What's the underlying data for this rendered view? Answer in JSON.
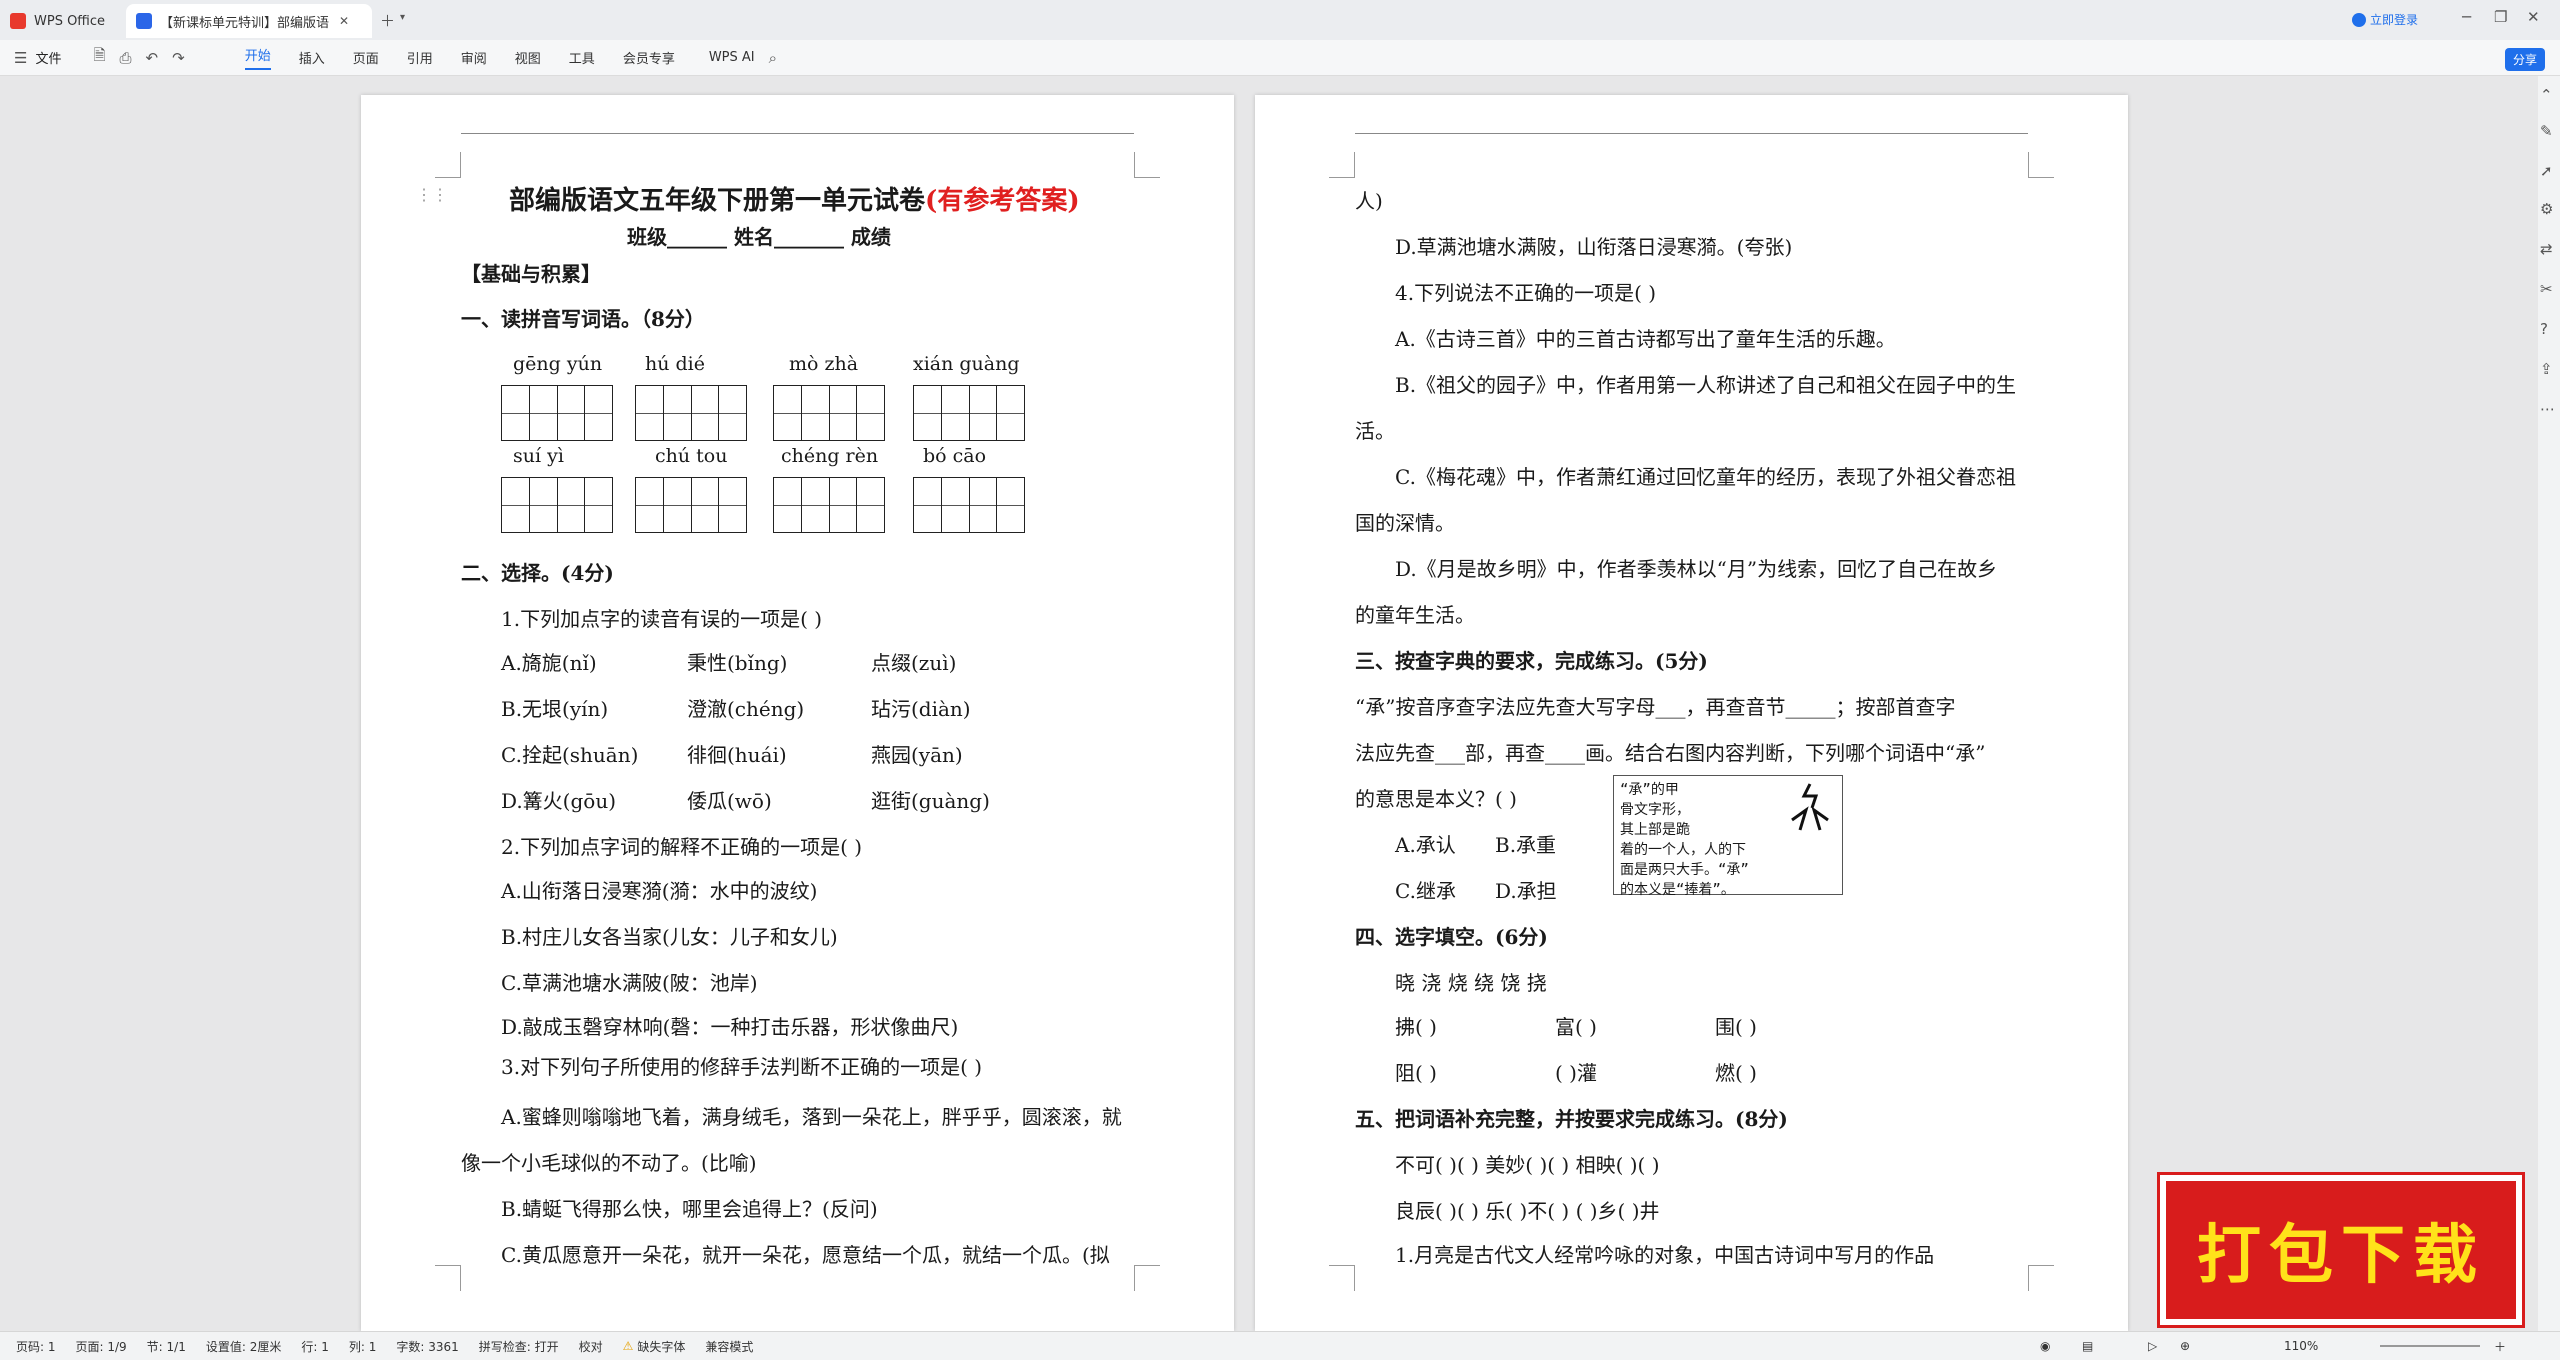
{
  "titlebar": {
    "app_tab": "WPS Office",
    "doc_tab": "【新课标单元特训】部编版语",
    "login": "立即登录"
  },
  "toolbar": {
    "file": "文件",
    "tabs": [
      "开始",
      "插入",
      "页面",
      "引用",
      "审阅",
      "视图",
      "工具",
      "会员专享"
    ],
    "ai": "WPS AI",
    "share": "分享"
  },
  "page1": {
    "title": "部编版语文五年级下册第一单元试卷",
    "title_suffix": "(有参考答案)",
    "info": "班级______   姓名_______   成绩",
    "section0": "【基础与积累】",
    "q1": "一、读拼音写词语。（8分）",
    "pinyin": [
      "gēng yún",
      "hú  dié",
      "mò  zhà",
      "xián guàng",
      "suí  yì",
      "chú tou",
      "chéng rèn",
      "bó  cāo"
    ],
    "q2": "二、选择。(4分)",
    "q2_1": "1.下列加点字的读音有误的一项是(      )",
    "a1": "A.旖旎(nǐ)",
    "a2": "秉性(bǐng)",
    "a3": "点缀(zuì)",
    "b1": "B.无垠(yín)",
    "b2": "澄澈(chéng)",
    "b3": "玷污(diàn)",
    "c1": "C.拴起(shuān)",
    "c2": "徘徊(huái)",
    "c3": "燕园(yān)",
    "d1": "D.篝火(gōu)",
    "d2": "倭瓜(wō)",
    "d3": "逛街(guàng)",
    "q2_2": "2.下列加点字词的解释不正确的一项是(   )",
    "q2_2a": "A.山衔落日浸寒漪(漪：水中的波纹)",
    "q2_2b": "B.村庄儿女各当家(儿女：儿子和女儿)",
    "q2_2c": "C.草满池塘水满陂(陂：池岸)",
    "q2_2d": "D.敲成玉磬穿林响(磬：一种打击乐器，形状像曲尺)",
    "q2_3": "3.对下列句子所使用的修辞手法判断不正确的一项是(   )",
    "q2_3a1": "A.蜜蜂则嗡嗡地飞着，满身绒毛，落到一朵花上，胖乎乎，圆滚滚，就",
    "q2_3a2": "像一个小毛球似的不动了。(比喻)",
    "q2_3b": "B.蜻蜓飞得那么快，哪里会追得上？(反问)",
    "q2_3c": "C.黄瓜愿意开一朵花，就开一朵花，愿意结一个瓜，就结一个瓜。(拟"
  },
  "page2": {
    "l1": "人)",
    "l2": "D.草满池塘水满陂，山衔落日浸寒漪。(夸张)",
    "l3": "4.下列说法不正确的一项是(    )",
    "l4": "A.《古诗三首》中的三首古诗都写出了童年生活的乐趣。",
    "l5": "B.《祖父的园子》中，作者用第一人称讲述了自己和祖父在园子中的生",
    "l6": "活。",
    "l7": "C.《梅花魂》中，作者萧红通过回忆童年的经历，表现了外祖父眷恋祖",
    "l8": "国的深情。",
    "l9": "D.《月是故乡明》中，作者季羡林以“月”为线索，回忆了自己在故乡",
    "l10": "的童年生活。",
    "q3": "三、按查字典的要求，完成练习。(5分)",
    "q3a": "“承”按音序查字法应先查大写字母___，再查音节_____；按部首查字",
    "q3b": "法应先查___部，再查____画。结合右图内容判断，下列哪个词语中“承”",
    "q3c": "的意思是本义？(    )",
    "opt_a": "A.承认",
    "opt_b": "B.承重",
    "opt_c": "C.继承",
    "opt_d": "D.承担",
    "dict": [
      "“承”的甲",
      "骨文字形，",
      "其上部是跪",
      "着的一个人，人的下",
      "面是两只大手。“承”",
      "的本义是“捧着”。"
    ],
    "q4": "四、选字填空。(6分)",
    "chars": "晓      浇      烧      绕      饶      挠",
    "q4r1a": "拂(     )",
    "q4r1b": "富(     )",
    "q4r1c": "围(     )",
    "q4r2a": "阻(     )",
    "q4r2b": "(     )灌",
    "q4r2c": "燃(     )",
    "q5": "五、把词语补充完整，并按要求完成练习。(8分)",
    "q5r1": "不可(   )(   )      美妙(   )(   )      相映(   )(   )",
    "q5r2": "良辰(   )(   )      乐(   )不(   )      (   )乡(   )井",
    "q5r3": "1.月亮是古代文人经常吟咏的对象，中国古诗词中写月的作品"
  },
  "status": {
    "page": "页码: 1",
    "pages": "页面: 1/9",
    "section": "节: 1/1",
    "setting": "设置值: 2厘米",
    "row": "行: 1",
    "col": "列: 1",
    "words": "字数: 3361",
    "spell": "拼写检查: 打开",
    "proof": "校对",
    "font_missing": "缺失字体",
    "compat": "兼容模式",
    "zoom": "110%"
  },
  "badge": "打包下载"
}
